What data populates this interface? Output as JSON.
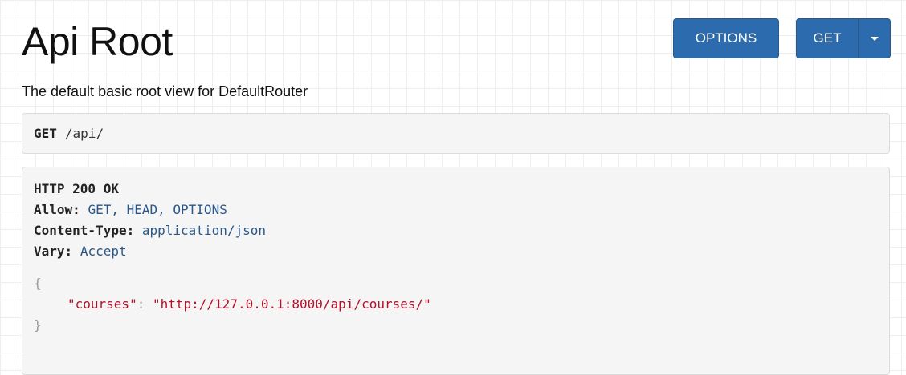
{
  "page": {
    "title": "Api Root",
    "description": "The default basic root view for DefaultRouter"
  },
  "toolbar": {
    "options_label": "OPTIONS",
    "get_label": "GET",
    "get_dropdown_icon": "caret-down-icon"
  },
  "request": {
    "method": "GET",
    "path": "/api/"
  },
  "response": {
    "status": "HTTP 200 OK",
    "headers": [
      {
        "key": "Allow:",
        "value": "GET, HEAD, OPTIONS"
      },
      {
        "key": "Content-Type:",
        "value": "application/json"
      },
      {
        "key": "Vary:",
        "value": "Accept"
      }
    ],
    "body": {
      "open_brace": "{",
      "close_brace": "}",
      "entries": [
        {
          "key": "\"courses\"",
          "separator": ":",
          "value": "\"http://127.0.0.1:8000/api/courses/\""
        }
      ]
    }
  },
  "colors": {
    "button_bg": "#2c6cae",
    "header_value": "#2a5788",
    "json_string": "#b3112a",
    "panel_bg": "#f5f5f5"
  }
}
